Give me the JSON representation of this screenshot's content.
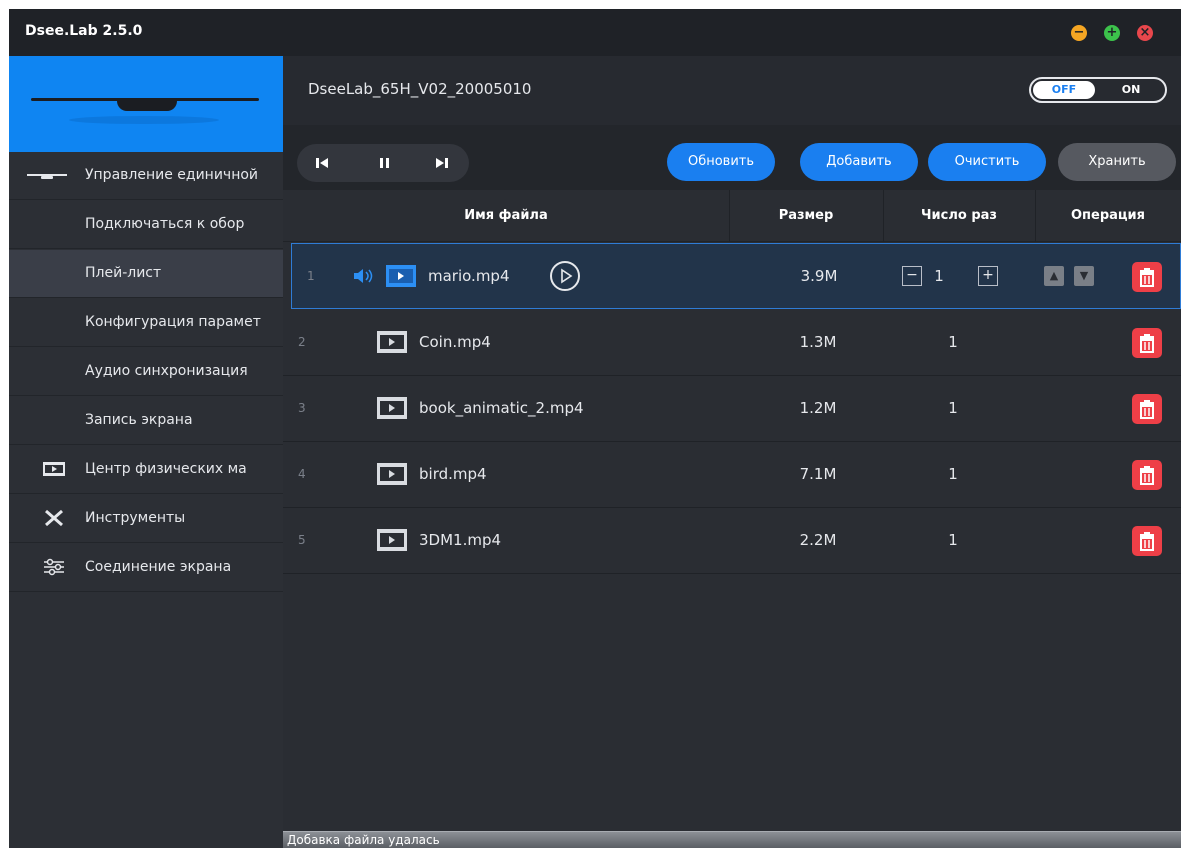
{
  "window": {
    "title": "Dsee.Lab 2.5.0"
  },
  "colors": {
    "accent": "#1a7ff0",
    "delete": "#ee3f47",
    "minimize": "#f5a623",
    "maximize": "#3cc24b",
    "close": "#e8474c"
  },
  "sidebar": {
    "items": [
      {
        "label": "Управление единичной",
        "icon": "device-icon"
      },
      {
        "label": "Подключаться к обор",
        "icon": null
      },
      {
        "label": "Плей-лист",
        "icon": null,
        "active": true
      },
      {
        "label": "Конфигурация парамет",
        "icon": null
      },
      {
        "label": "Аудио синхронизация",
        "icon": null
      },
      {
        "label": "Запись экрана",
        "icon": null
      },
      {
        "label": "Центр физических ма",
        "icon": "film-icon"
      },
      {
        "label": "Инструменты",
        "icon": "tools-icon"
      },
      {
        "label": "Соединение экрана",
        "icon": "sliders-icon"
      }
    ]
  },
  "device": {
    "name": "DseeLab_65H_V02_20005010",
    "toggle_off": "OFF",
    "toggle_on": "ON"
  },
  "toolbar": {
    "refresh": "Обновить",
    "add": "Добавить",
    "clear": "Очистить",
    "save": "Хранить"
  },
  "table": {
    "headers": {
      "filename": "Имя файла",
      "size": "Размер",
      "count": "Число раз",
      "operation": "Операция"
    },
    "rows": [
      {
        "index": "1",
        "filename": "mario.mp4",
        "size": "3.9M",
        "count": "1",
        "playing": true
      },
      {
        "index": "2",
        "filename": "Coin.mp4",
        "size": "1.3M",
        "count": "1"
      },
      {
        "index": "3",
        "filename": "book_animatic_2.mp4",
        "size": "1.2M",
        "count": "1"
      },
      {
        "index": "4",
        "filename": "bird.mp4",
        "size": "7.1M",
        "count": "1"
      },
      {
        "index": "5",
        "filename": "3DM1.mp4",
        "size": "2.2M",
        "count": "1"
      }
    ]
  },
  "status": {
    "message": "Добавка файла удалась"
  }
}
